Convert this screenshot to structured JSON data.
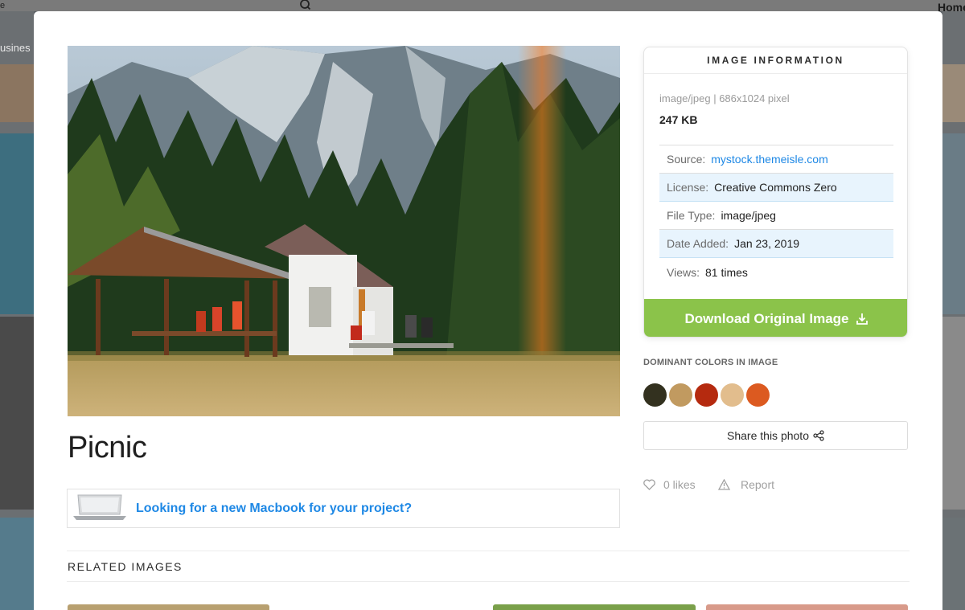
{
  "background": {
    "nav_home": "Home",
    "edge_letter": "e",
    "category_text": "usines"
  },
  "photo": {
    "title": "Picnic"
  },
  "promo": {
    "text": "Looking for a new Macbook for your project?"
  },
  "related": {
    "title": "RELATED IMAGES"
  },
  "info": {
    "header": "IMAGE INFORMATION",
    "meta": "image/jpeg | 686x1024 pixel",
    "size": "247 KB",
    "rows": [
      {
        "label": "Source:",
        "value": "mystock.themeisle.com"
      },
      {
        "label": "License:",
        "value": "Creative Commons Zero"
      },
      {
        "label": "File Type:",
        "value": "image/jpeg"
      },
      {
        "label": "Date Added:",
        "value": "Jan 23, 2019"
      },
      {
        "label": "Views:",
        "value": "81 times"
      }
    ],
    "download_label": "Download Original Image"
  },
  "dominant": {
    "title": "DOMINANT COLORS IN IMAGE",
    "colors": [
      "#33311f",
      "#c19a60",
      "#b52a0f",
      "#e2bd8d",
      "#dc5a20"
    ]
  },
  "share": {
    "label": "Share this photo"
  },
  "likes": {
    "label": "0 likes"
  },
  "report": {
    "label": "Report"
  },
  "colors": {
    "accent_green": "#8bc34a",
    "link_blue": "#1e88e5",
    "row_highlight": "#e8f4fd"
  },
  "icons": [
    "search-icon",
    "download-icon",
    "share-icon",
    "heart-icon",
    "warning-icon"
  ]
}
